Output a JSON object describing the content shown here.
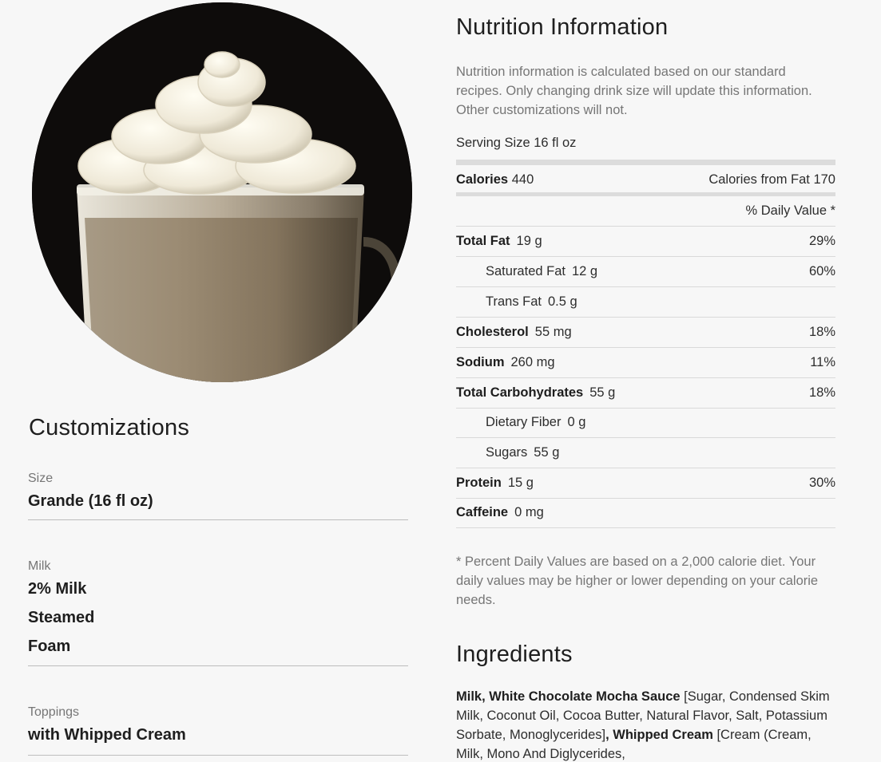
{
  "product": {
    "image_alt": "White Chocolate Mocha with whipped cream"
  },
  "customizations": {
    "heading": "Customizations",
    "groups": [
      {
        "label": "Size",
        "values": [
          "Grande (16 fl oz)"
        ]
      },
      {
        "label": "Milk",
        "values": [
          "2% Milk",
          "Steamed",
          "Foam"
        ]
      },
      {
        "label": "Toppings",
        "values": [
          "with Whipped Cream"
        ]
      }
    ]
  },
  "nutrition": {
    "heading": "Nutrition Information",
    "description": "Nutrition information is calculated based on our standard recipes. Only changing drink size will update this information. Other customizations will not.",
    "serving_size": "Serving Size 16 fl oz",
    "calories_label": "Calories",
    "calories_value": "440",
    "calories_from_fat": "Calories from Fat 170",
    "daily_value_header": "% Daily Value *",
    "rows": [
      {
        "label": "Total Fat",
        "amount": "19 g",
        "dv": "29%"
      },
      {
        "label": "Saturated Fat",
        "amount": "12 g",
        "dv": "60%"
      },
      {
        "label": "Trans Fat",
        "amount": "0.5 g",
        "dv": ""
      },
      {
        "label": "Cholesterol",
        "amount": "55 mg",
        "dv": "18%"
      },
      {
        "label": "Sodium",
        "amount": "260 mg",
        "dv": "11%"
      },
      {
        "label": "Total Carbohydrates",
        "amount": "55 g",
        "dv": "18%"
      },
      {
        "label": "Dietary Fiber",
        "amount": "0 g",
        "dv": ""
      },
      {
        "label": "Sugars",
        "amount": "55 g",
        "dv": ""
      },
      {
        "label": "Protein",
        "amount": "15 g",
        "dv": "30%"
      },
      {
        "label": "Caffeine",
        "amount": "0 mg",
        "dv": ""
      }
    ],
    "footnote": "* Percent Daily Values are based on a 2,000 calorie diet. Your daily values may be higher or lower depending on your calorie needs."
  },
  "ingredients": {
    "heading": "Ingredients",
    "item1_bold": "Milk, White Chocolate Mocha Sauce",
    "item1_rest": " [Sugar, Condensed Skim Milk, Coconut Oil, Cocoa Butter, Natural Flavor, Salt, Potassium Sorbate, Monoglycerides]",
    "item2_bold": ", Whipped Cream",
    "item2_rest": " [Cream (Cream, Milk, Mono And Diglycerides,"
  }
}
